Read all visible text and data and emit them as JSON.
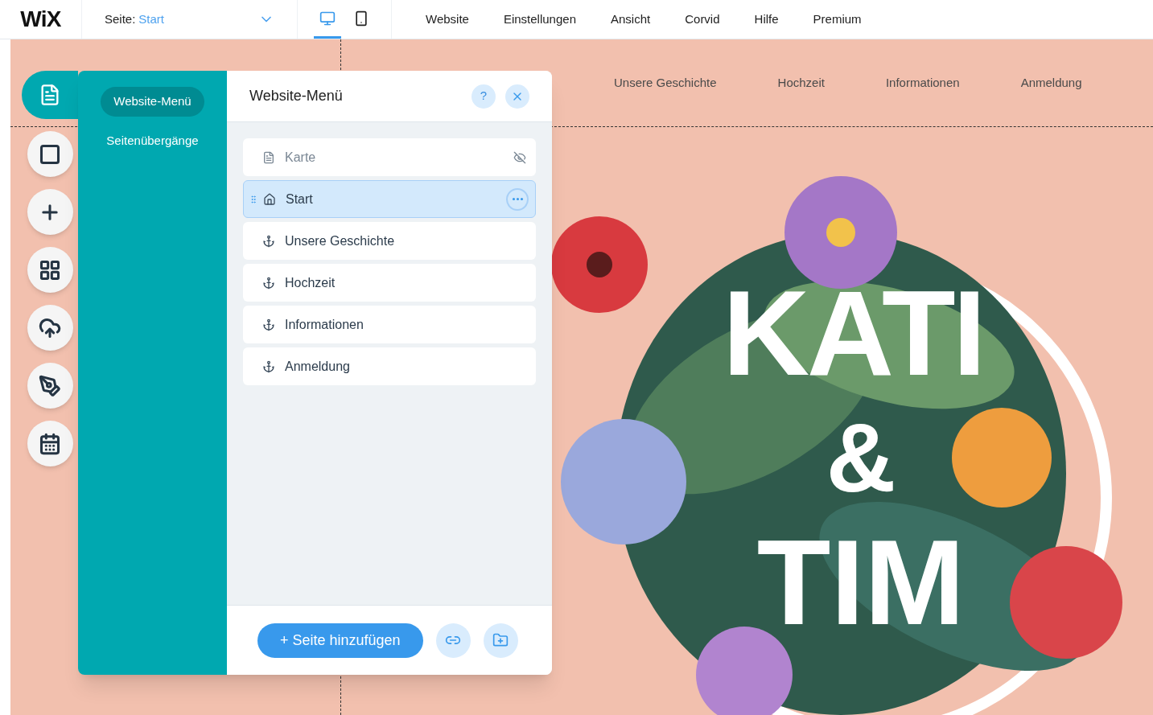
{
  "topbar": {
    "logo": "WiX",
    "page_label": "Seite:",
    "page_value": "Start",
    "devices": [
      {
        "kind": "desktop",
        "selected": true
      },
      {
        "kind": "mobile",
        "selected": false
      }
    ],
    "menu": [
      "Website",
      "Einstellungen",
      "Ansicht",
      "Corvid",
      "Hilfe",
      "Premium"
    ]
  },
  "panel": {
    "tabs": [
      {
        "label": "Website-Menü",
        "selected": true
      },
      {
        "label": "Seitenübergänge",
        "selected": false
      }
    ],
    "title": "Website-Menü",
    "help": "?",
    "pages": [
      {
        "label": "Karte",
        "kind": "page",
        "hidden": true,
        "selected": false
      },
      {
        "label": "Start",
        "kind": "home",
        "hidden": false,
        "selected": true
      },
      {
        "label": "Unsere Geschichte",
        "kind": "anchor",
        "hidden": false,
        "selected": false
      },
      {
        "label": "Hochzeit",
        "kind": "anchor",
        "hidden": false,
        "selected": false
      },
      {
        "label": "Informationen",
        "kind": "anchor",
        "hidden": false,
        "selected": false
      },
      {
        "label": "Anmeldung",
        "kind": "anchor",
        "hidden": false,
        "selected": false
      }
    ],
    "add_button": "+ Seite hinzufügen"
  },
  "site": {
    "nav": [
      "Unsere Geschichte",
      "Hochzeit",
      "Informationen",
      "Anmeldung"
    ],
    "hero": {
      "line_1": "KATI",
      "line_2": "&",
      "line_3": "TIM"
    }
  }
}
